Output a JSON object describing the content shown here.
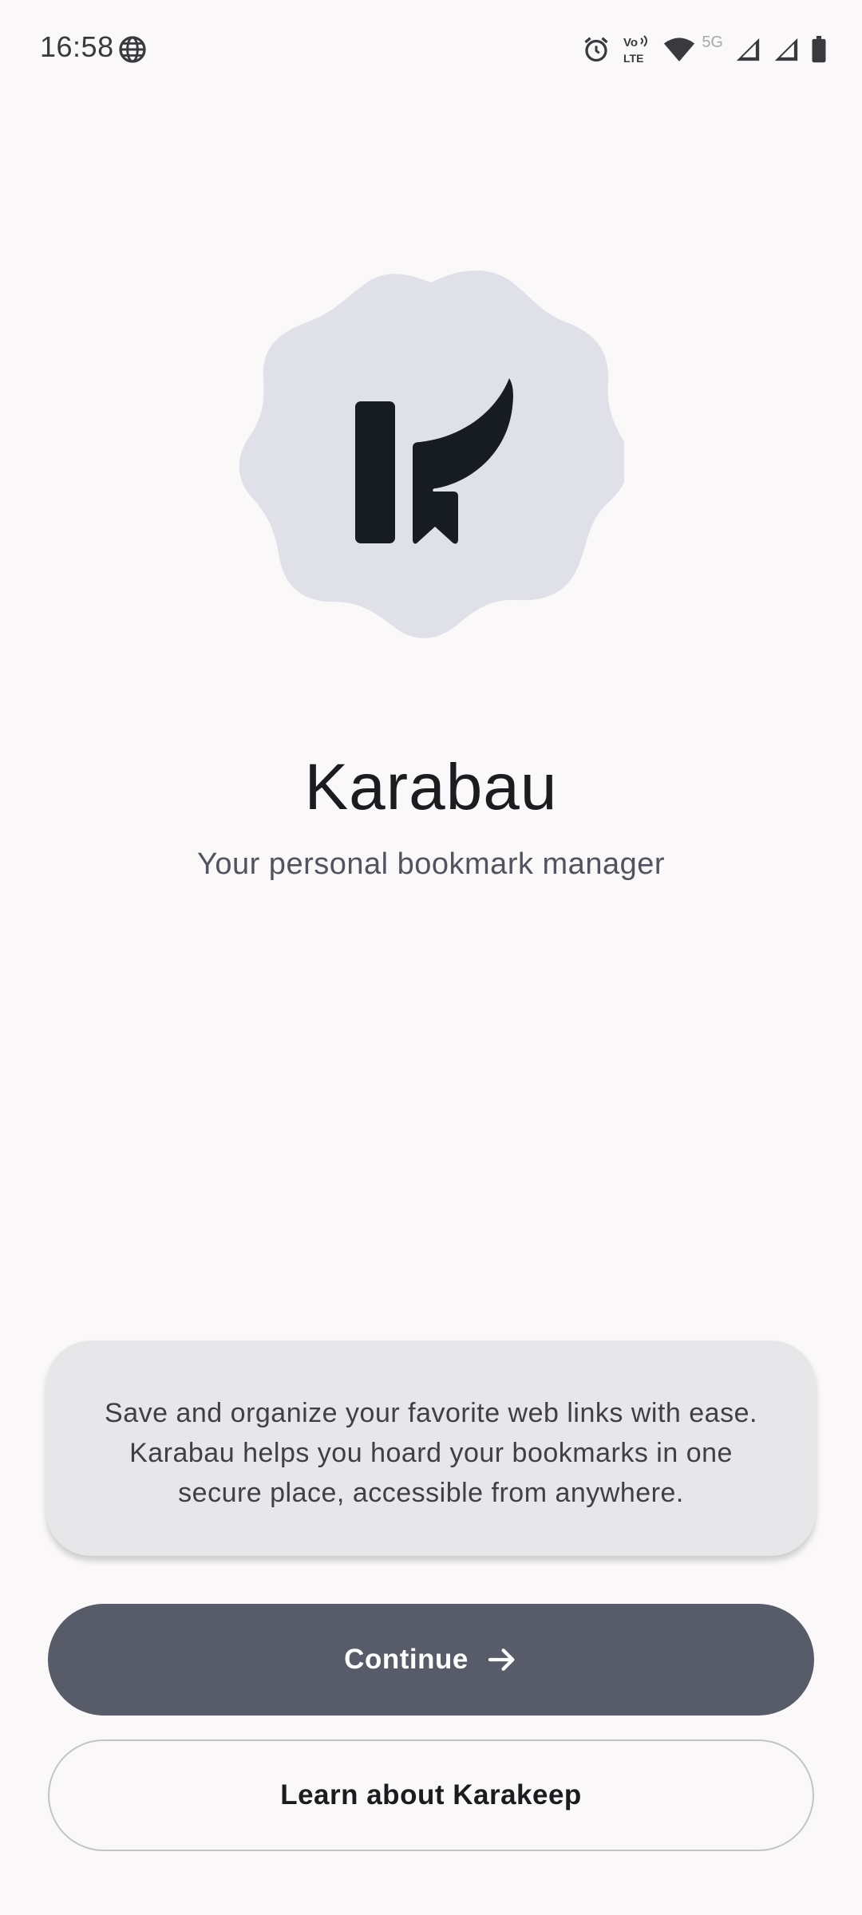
{
  "status_bar": {
    "time": "16:58",
    "network_label": "5G",
    "volte_top": "Vo",
    "volte_bottom": "LTE",
    "icons": [
      "globe-icon",
      "alarm-icon",
      "volte-icon",
      "wifi-icon",
      "signal-icon",
      "signal-icon",
      "battery-icon"
    ]
  },
  "app": {
    "logo_icon": "karakeep-bookmark-logo",
    "title": "Karabau",
    "subtitle": "Your personal bookmark manager"
  },
  "info_card": {
    "text": "Save and organize your favorite web links with ease. Karabau helps you hoard your bookmarks in one secure place, accessible from anywhere."
  },
  "actions": {
    "continue_label": "Continue",
    "continue_icon": "arrow-right-icon",
    "learn_label": "Learn about Karakeep"
  },
  "colors": {
    "background": "#faf8f9",
    "logo_badge": "#dfe0e8",
    "logo_mark": "#171c23",
    "card": "#e7e6e8",
    "primary_button": "#575c68"
  }
}
